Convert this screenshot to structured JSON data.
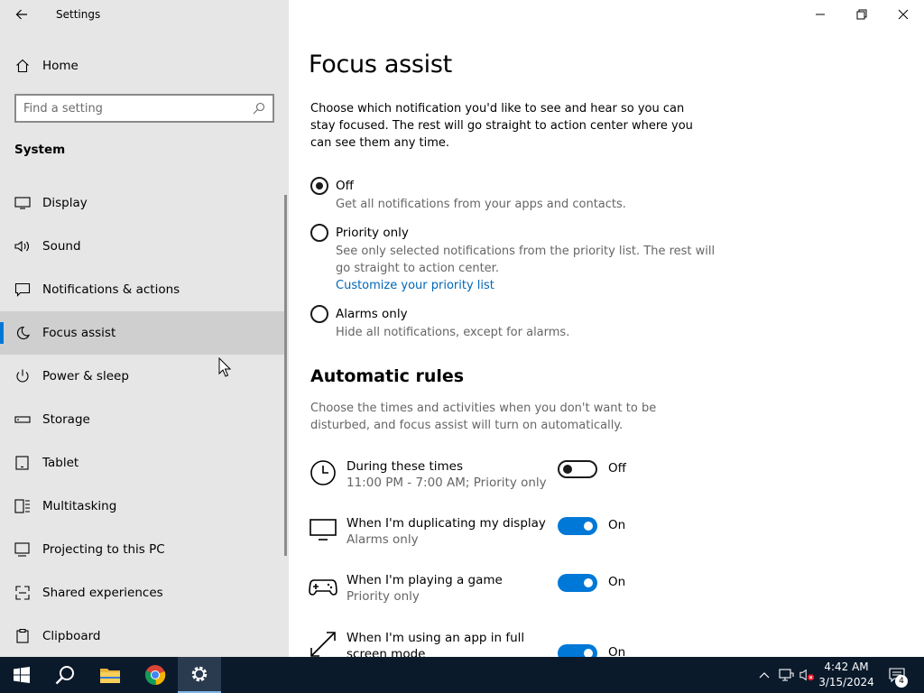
{
  "window": {
    "title": "Settings",
    "controls": [
      "minimize",
      "restore",
      "close"
    ]
  },
  "sidebar": {
    "home_label": "Home",
    "search": {
      "placeholder": "Find a setting"
    },
    "section_title": "System",
    "items": [
      {
        "label": "Display",
        "icon": "display-icon",
        "selected": false
      },
      {
        "label": "Sound",
        "icon": "sound-icon",
        "selected": false
      },
      {
        "label": "Notifications & actions",
        "icon": "notifications-icon",
        "selected": false
      },
      {
        "label": "Focus assist",
        "icon": "moon-icon",
        "selected": true
      },
      {
        "label": "Power & sleep",
        "icon": "power-icon",
        "selected": false
      },
      {
        "label": "Storage",
        "icon": "storage-icon",
        "selected": false
      },
      {
        "label": "Tablet",
        "icon": "tablet-icon",
        "selected": false
      },
      {
        "label": "Multitasking",
        "icon": "multitasking-icon",
        "selected": false
      },
      {
        "label": "Projecting to this PC",
        "icon": "projecting-icon",
        "selected": false
      },
      {
        "label": "Shared experiences",
        "icon": "shared-experiences-icon",
        "selected": false
      },
      {
        "label": "Clipboard",
        "icon": "clipboard-icon",
        "selected": false
      }
    ]
  },
  "main": {
    "title": "Focus assist",
    "intro": "Choose which notification you'd like to see and hear so you can stay focused. The rest will go straight to action center where you can see them any time.",
    "options": [
      {
        "label": "Off",
        "desc": "Get all notifications from your apps and contacts.",
        "checked": true
      },
      {
        "label": "Priority only",
        "desc": "See only selected notifications from the priority list. The rest will go straight to action center.",
        "link": "Customize your priority list",
        "checked": false
      },
      {
        "label": "Alarms only",
        "desc": "Hide all notifications, except for alarms.",
        "checked": false
      }
    ],
    "rules_title": "Automatic rules",
    "rules_desc": "Choose the times and activities when you don't want to be disturbed, and focus assist will turn on automatically.",
    "rules": [
      {
        "title": "During these times",
        "subtitle": "11:00 PM - 7:00 AM; Priority only",
        "state": "Off",
        "on": false,
        "icon": "clock-icon"
      },
      {
        "title": "When I'm duplicating my display",
        "subtitle": "Alarms only",
        "state": "On",
        "on": true,
        "icon": "monitor-icon"
      },
      {
        "title": "When I'm playing a game",
        "subtitle": "Priority only",
        "state": "On",
        "on": true,
        "icon": "gamepad-icon"
      },
      {
        "title": "When I'm using an app in full screen mode",
        "subtitle": "",
        "state": "On",
        "on": true,
        "icon": "fullscreen-icon"
      }
    ]
  },
  "taskbar": {
    "apps": [
      "start-icon",
      "search-icon",
      "file-explorer-icon",
      "chrome-icon",
      "settings-icon"
    ],
    "active_app": "settings-icon",
    "time": "4:42 AM",
    "date": "3/15/2024",
    "notification_count": "4"
  },
  "colors": {
    "accent": "#0078d7",
    "link": "#0067b8",
    "sidebar_bg": "#e6e6e6",
    "taskbar_bg": "#0b1a2b"
  }
}
